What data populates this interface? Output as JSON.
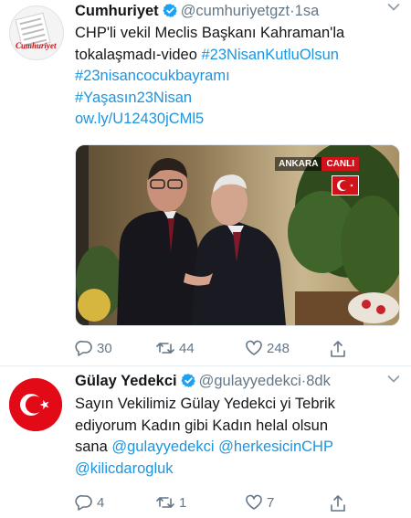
{
  "tweets": [
    {
      "author": "Cumhuriyet",
      "handle": "@cumhuriyetgzt",
      "separator": "·",
      "time": "1sa",
      "avatar_text": "Cumhuriyet",
      "text_line_1": "CHP'li vekil Meclis Başkanı Kahraman'la",
      "text_line_2_plain": "tokalaşmadı-video ",
      "hashtag_1": "#23NisanKutluOlsun",
      "hashtag_2": "#23nisancocukbayramı",
      "hashtag_3": "#Yaşasın23Nisan",
      "short_link": "ow.ly/U12430jCMl5",
      "video_overlay": {
        "location": "ANKARA",
        "live": "CANLI"
      },
      "actions": {
        "replies": "30",
        "retweets": "44",
        "likes": "248"
      }
    },
    {
      "author": "Gülay Yedekci",
      "handle": "@gulayyedekci",
      "separator": "·",
      "time": "8dk",
      "text_line_1": "Sayın Vekilimiz Gülay Yedekci yi Tebrik",
      "text_line_2": "ediyorum Kadın gibi Kadın helal olsun",
      "text_line_3_plain": "sana ",
      "mention_1": "@gulayyedekci",
      "mention_2": "@herkesicinCHP",
      "mention_3": "@kilicdarogluk",
      "actions": {
        "replies": "4",
        "retweets": "1",
        "likes": "7"
      }
    }
  ],
  "colors": {
    "link": "#1b95e0",
    "verified": "#1da1f2",
    "muted": "#657786",
    "flag_red": "#e30a17"
  }
}
